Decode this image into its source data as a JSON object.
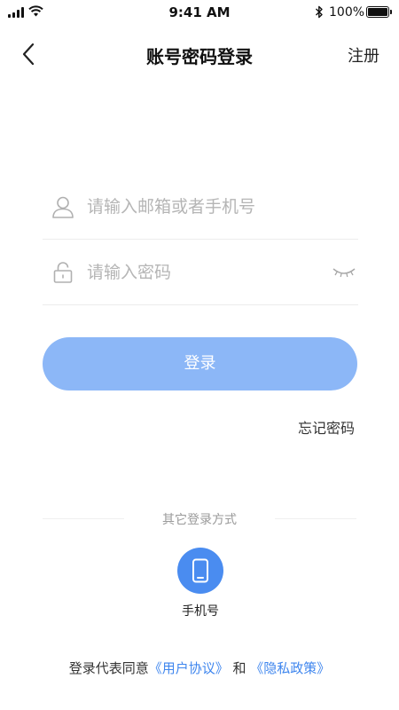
{
  "status_bar": {
    "time": "9:41 AM",
    "battery": "100%"
  },
  "nav": {
    "title": "账号密码登录",
    "register_label": "注册"
  },
  "form": {
    "email_placeholder": "请输入邮箱或者手机号",
    "email_value": "",
    "password_placeholder": "请输入密码",
    "password_value": "",
    "login_label": "登录",
    "forgot_label": "忘记密码"
  },
  "other_login": {
    "divider_label": "其它登录方式",
    "phone_label": "手机号"
  },
  "agreement": {
    "prefix": "登录代表同意",
    "user_agreement": "《用户协议》",
    "conjunction": " 和 ",
    "privacy_policy": "《隐私政策》"
  },
  "colors": {
    "accent": "#4a8cf0",
    "login_button": "#8cb7f7",
    "link": "#3f86ee",
    "placeholder": "#b5b5b5"
  },
  "icons": {
    "back": "chevron-left-icon",
    "user": "user-icon",
    "lock": "lock-icon",
    "eye": "eye-closed-icon",
    "phone": "phone-icon"
  }
}
